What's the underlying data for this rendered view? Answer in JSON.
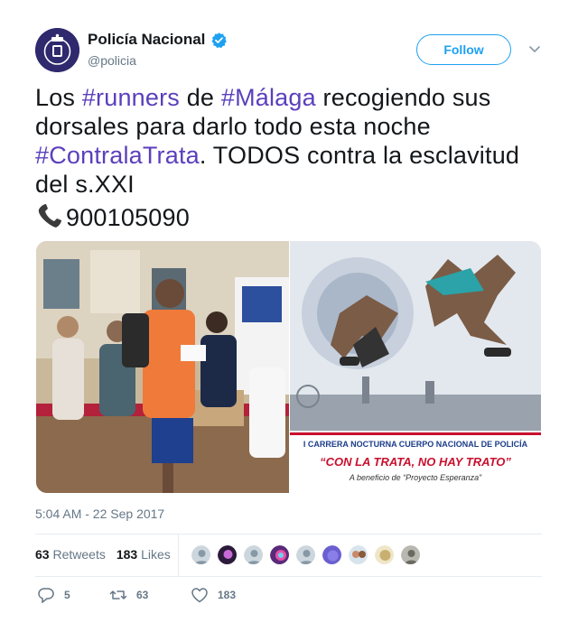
{
  "author": {
    "display_name": "Policía Nacional",
    "handle": "@policia",
    "verified": true,
    "avatar_color": "#2f2a6e"
  },
  "follow": {
    "label": "Follow",
    "color": "#1da1f2"
  },
  "tweet": {
    "parts": [
      {
        "t": "Los ",
        "tag": false
      },
      {
        "t": "#runners",
        "tag": true
      },
      {
        "t": " de ",
        "tag": false
      },
      {
        "t": "#Málaga",
        "tag": true
      },
      {
        "t": " recogiendo sus dorsales para darlo todo esta noche ",
        "tag": false
      },
      {
        "t": "#ContralaTrata",
        "tag": true
      },
      {
        "t": ". TODOS contra la esclavitud del s.XXI",
        "tag": false
      }
    ],
    "phone": "900105090",
    "phone_icon": "telephone-icon",
    "hashtag_color": "#5b3fbc"
  },
  "media": {
    "poster_line1": "I CARRERA NOCTURNA CUERPO NACIONAL DE POLICÍA",
    "poster_line2": "“CON LA TRATA, NO HAY TRATO”",
    "poster_line3": "A beneficio de “Proyecto Esperanza”"
  },
  "timestamp": "5:04 AM - 22 Sep 2017",
  "stats": {
    "retweets_count": "63",
    "retweets_label": "Retweets",
    "likes_count": "183",
    "likes_label": "Likes"
  },
  "actions": {
    "reply_count": "5",
    "retweet_count": "63",
    "like_count": "183"
  }
}
